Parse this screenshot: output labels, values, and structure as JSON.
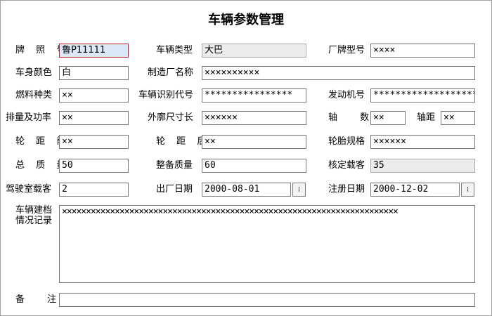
{
  "title": "车辆参数管理",
  "fields": {
    "plate_label": "牌 照 号",
    "plate_value": "鲁P11111",
    "vehicle_type_label": "车辆类型",
    "vehicle_type_value": "大巴",
    "model_label": "厂牌型号",
    "model_value": "××××",
    "body_color_label": "车身颜色",
    "body_color_value": "白",
    "manufacturer_label": "制造厂名称",
    "manufacturer_value": "××××××××××",
    "fuel_label": "燃料种类",
    "fuel_value": "××",
    "vin_label": "车辆识别代号",
    "vin_value": "****************",
    "engine_label": "发动机号",
    "engine_value": "*******************",
    "displacement_label": "排量及功率",
    "displacement_value": "××",
    "dimensions_label": "外廓尺寸长",
    "dimensions_value": "××××××",
    "axle_label": "轴 数",
    "axle_value": "××",
    "wheelbase_label": "轴距",
    "wheelbase_value": "××",
    "front_track_label": "轮 距 前",
    "front_track_value": "××",
    "rear_track_label": "轮 距 后",
    "rear_track_value": "××",
    "tire_label": "轮胎规格",
    "tire_value": "××××××",
    "gross_mass_label": "总 质 量",
    "gross_mass_value": "50",
    "curb_mass_label": "整备质量",
    "curb_mass_value": "60",
    "rated_pass_label": "核定载客",
    "rated_pass_value": "35",
    "cab_pass_label": "驾驶室载客",
    "cab_pass_value": "2",
    "mfg_date_label": "出厂日期",
    "mfg_date_value": "2000-08-01",
    "reg_date_label": "注册日期",
    "reg_date_value": "2000-12-02",
    "dropdown_glyph": "⁝",
    "record_label_1": "车辆建档",
    "record_label_2": "情况记录",
    "record_value": "××××××××××××××××××××××××××××××××××××××××××××××××××××××××××××××××××××××",
    "remark_label": "备 注",
    "remark_value": ""
  }
}
